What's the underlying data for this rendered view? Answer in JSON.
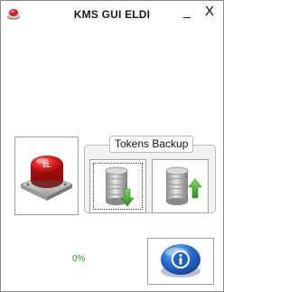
{
  "window": {
    "title": "KMS GUI ELDI",
    "minimize_glyph": "_",
    "close_glyph": "X",
    "app_icon": "red-button-icon"
  },
  "activate_button": {
    "icon": "red-button-icon",
    "icon_text": "EL"
  },
  "tokens_backup": {
    "legend": "Tokens Backup",
    "backup_icon": "database-download-icon",
    "restore_icon": "database-upload-icon"
  },
  "status": {
    "progress": "0%"
  },
  "about_button": {
    "icon": "info-icon"
  },
  "colors": {
    "progress_text": "#2e9a2e",
    "accent_red": "#d42020",
    "accent_green": "#3aa83a",
    "accent_blue": "#2a6fd6"
  }
}
